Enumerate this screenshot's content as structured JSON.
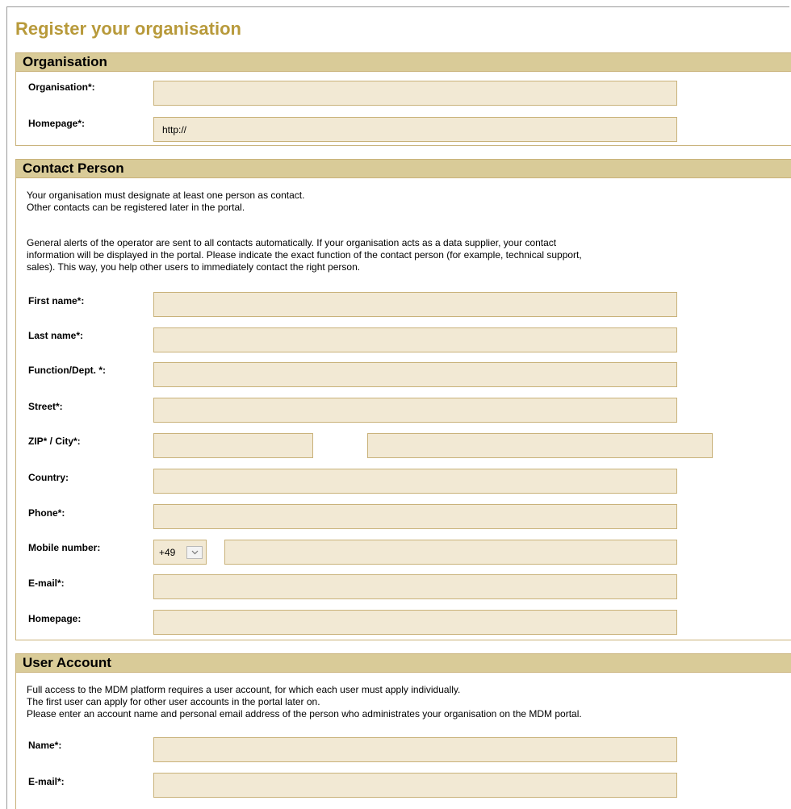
{
  "page_title": "Register your organisation",
  "organisation_section": {
    "title": "Organisation",
    "organisation_label": "Organisation*:",
    "organisation_value": "",
    "homepage_label": "Homepage*:",
    "homepage_value": "http://"
  },
  "contact_section": {
    "title": "Contact Person",
    "intro_line1": "Your organisation must designate at least one person as contact.",
    "intro_line2": "Other contacts can be registered later in the portal.",
    "info_line1": "General alerts of the operator are sent to all contacts automatically. If your organisation acts as a data supplier, your contact",
    "info_line2": "information will be displayed in the portal. Please indicate the exact function of the contact person (for example, technical support,",
    "info_line3": "sales). This way, you help other users to immediately contact the right person.",
    "first_name_label": "First name*:",
    "last_name_label": "Last name*:",
    "function_label": "Function/Dept. *:",
    "street_label": "Street*:",
    "zip_city_label": "ZIP* / City*:",
    "country_label": "Country:",
    "phone_label": "Phone*:",
    "mobile_label": "Mobile number:",
    "mobile_prefix": "+49",
    "email_label": "E-mail*:",
    "homepage_label": "Homepage:"
  },
  "user_section": {
    "title": "User Account",
    "line1": "Full access to the MDM platform requires a user account, for which each user must apply individually.",
    "line2": "The first user can apply for other user accounts in the portal later on.",
    "line3": "Please enter an account name and personal email address of the person who administrates your organisation on the MDM portal.",
    "name_label": "Name*:",
    "email_label": "E-mail*:"
  },
  "colors": {
    "title_gold": "#b89a3b",
    "header_bg": "#d9cb98",
    "field_bg": "#f2e9d4",
    "border": "#c9b27a"
  }
}
